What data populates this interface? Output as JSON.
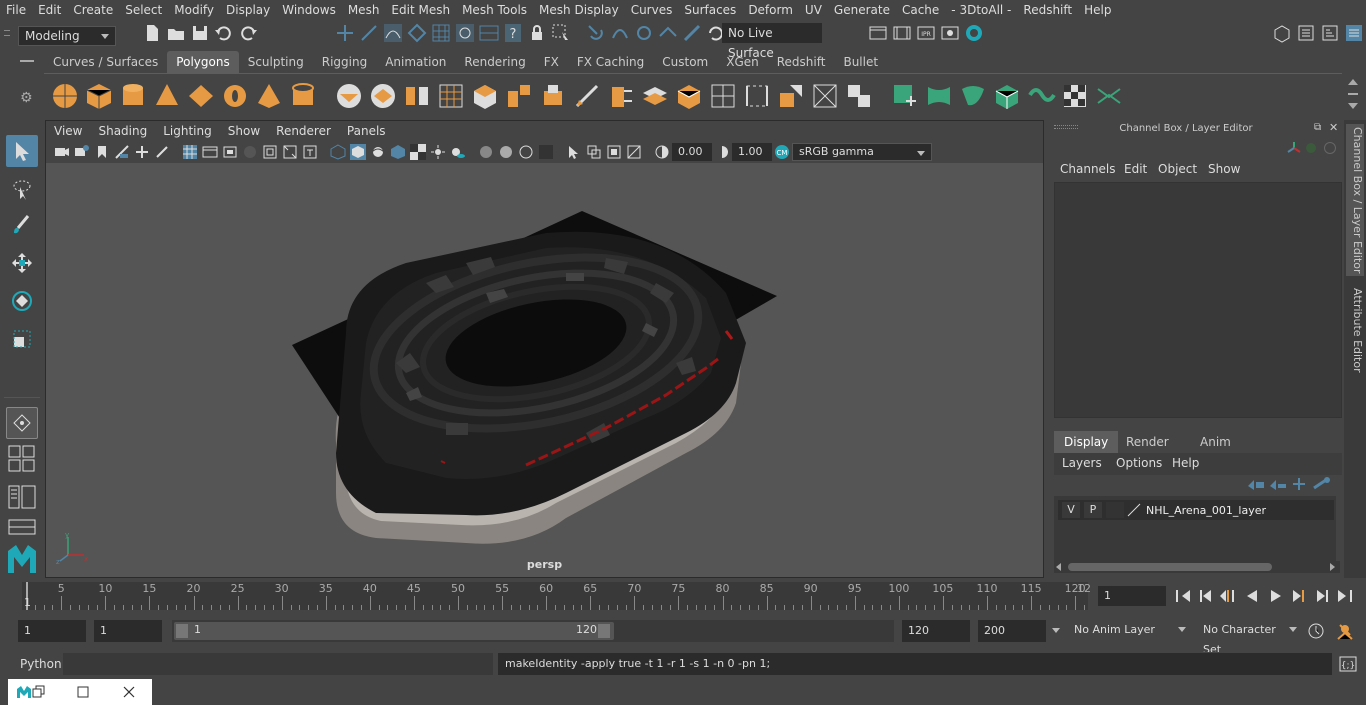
{
  "menubar": {
    "items": [
      "File",
      "Edit",
      "Create",
      "Select",
      "Modify",
      "Display",
      "Windows",
      "Mesh",
      "Edit Mesh",
      "Mesh Tools",
      "Mesh Display",
      "Curves",
      "Surfaces",
      "Deform",
      "UV",
      "Generate",
      "Cache",
      "- 3DtoAll -",
      "Redshift",
      "Help"
    ]
  },
  "status_line": {
    "mode": "Modeling",
    "live_surface": "No Live Surface"
  },
  "shelf": {
    "tabs": [
      "Curves / Surfaces",
      "Polygons",
      "Sculpting",
      "Rigging",
      "Animation",
      "Rendering",
      "FX",
      "FX Caching",
      "Custom",
      "XGen",
      "Redshift",
      "Bullet"
    ],
    "active_tab": "Polygons"
  },
  "viewport": {
    "menus": [
      "View",
      "Shading",
      "Lighting",
      "Show",
      "Renderer",
      "Panels"
    ],
    "exposure": "0.00",
    "gamma": "1.00",
    "color_space": "sRGB gamma",
    "camera": "persp"
  },
  "channel_box": {
    "title": "Channel Box / Layer Editor",
    "menus": [
      "Channels",
      "Edit",
      "Object",
      "Show"
    ]
  },
  "layer_editor": {
    "tabs": [
      "Display",
      "Render",
      "Anim"
    ],
    "active_tab": "Display",
    "menus": [
      "Layers",
      "Options",
      "Help"
    ],
    "layers": [
      {
        "v": "V",
        "p": "P",
        "name": "NHL_Arena_001_layer"
      }
    ]
  },
  "side_tabs": [
    "Channel Box / Layer Editor",
    "Attribute Editor"
  ],
  "timeline": {
    "ticks": [
      5,
      10,
      15,
      20,
      25,
      30,
      35,
      40,
      45,
      50,
      55,
      60,
      65,
      70,
      75,
      80,
      85,
      90,
      95,
      100,
      105,
      110,
      115,
      120
    ],
    "start_label": "1",
    "end_label": "12",
    "current_frame": "1"
  },
  "range": {
    "start": "1",
    "playback_start": "1",
    "slider_start": "1",
    "slider_end": "120",
    "playback_end": "120",
    "end": "200",
    "anim_layer": "No Anim Layer",
    "char_set": "No Character Set"
  },
  "command_line": {
    "language": "Python",
    "feedback": "makeIdentity -apply true -t 1 -r 1 -s 1 -n 0 -pn 1;"
  },
  "colors": {
    "accent_blue": "#5285a6",
    "shelf_orange": "#e69a43",
    "shelf_green": "#3aa57a",
    "maya_teal": "#1fa9b8"
  }
}
